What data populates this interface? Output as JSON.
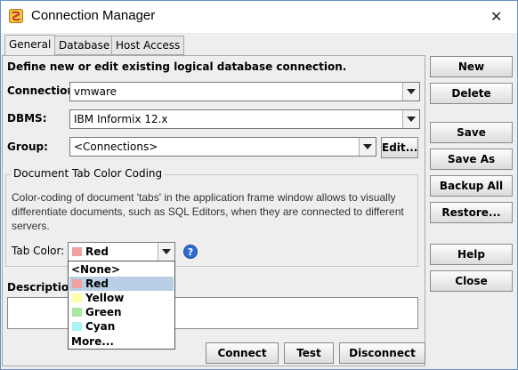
{
  "window": {
    "title": "Connection Manager"
  },
  "tabs": [
    {
      "label": "General"
    },
    {
      "label": "Database"
    },
    {
      "label": "Host Access"
    }
  ],
  "general": {
    "header": "Define new or edit existing logical database connection.",
    "connection": {
      "label": "Connection:",
      "value": "vmware"
    },
    "dbms": {
      "label": "DBMS:",
      "value": "IBM Informix 12.x"
    },
    "group": {
      "label": "Group:",
      "value": "<Connections>",
      "edit_label": "Edit..."
    },
    "color_coding": {
      "title": "Document Tab Color Coding",
      "description": "Color-coding of document 'tabs' in the application frame window allows to visually differentiate documents, such as SQL Editors, when they are connected to different servers.",
      "tab_color_label": "Tab Color:",
      "selected": "Red",
      "selected_color": "#f2a0a0",
      "options": [
        {
          "label": "<None>",
          "color": ""
        },
        {
          "label": "Red",
          "color": "#f2a0a0"
        },
        {
          "label": "Yellow",
          "color": "#ffffa8"
        },
        {
          "label": "Green",
          "color": "#a8e8a0"
        },
        {
          "label": "Cyan",
          "color": "#a8f4f4"
        },
        {
          "label": "More...",
          "color": ""
        }
      ],
      "help_icon": "help-icon"
    },
    "description_label": "Description:"
  },
  "side_buttons": {
    "new": "New",
    "delete": "Delete",
    "save": "Save",
    "save_as": "Save As",
    "backup_all": "Backup All",
    "restore": "Restore...",
    "help": "Help",
    "close": "Close"
  },
  "bottom_buttons": {
    "connect": "Connect",
    "test": "Test",
    "disconnect": "Disconnect"
  },
  "icons": {
    "app": "app-icon",
    "close": "close-icon"
  }
}
